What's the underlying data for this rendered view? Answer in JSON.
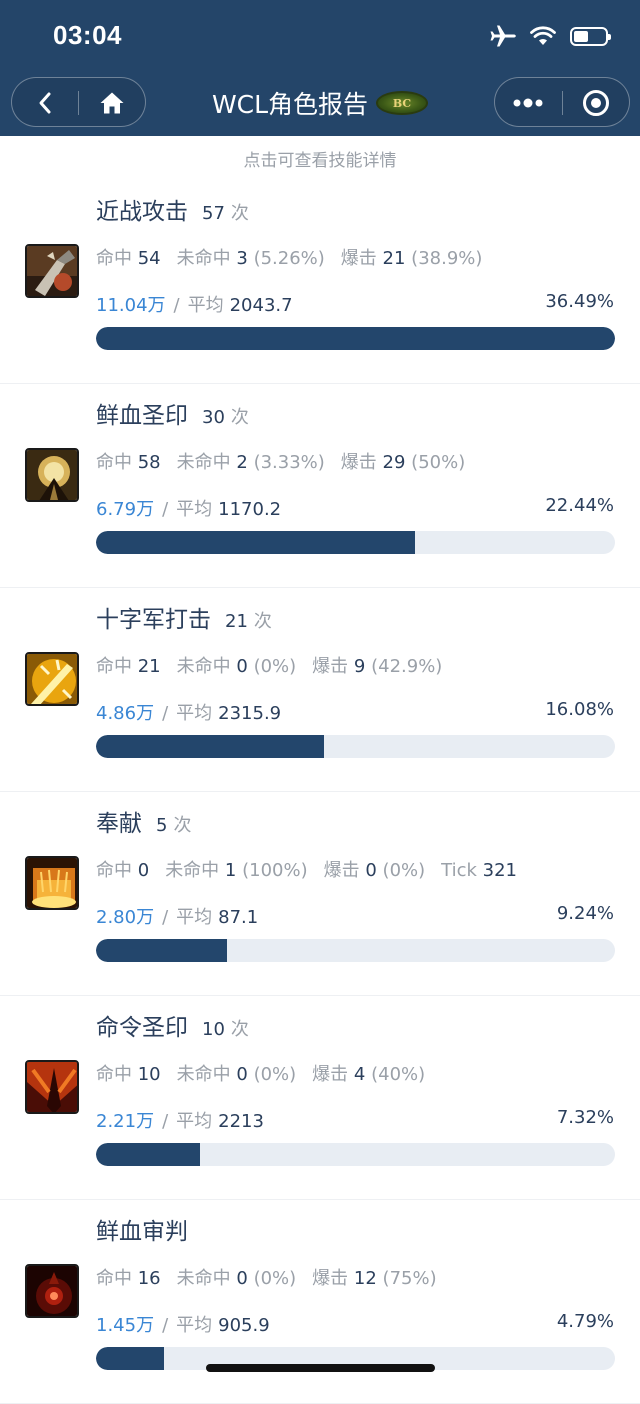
{
  "status_bar": {
    "time": "03:04",
    "icons": [
      "airplane-icon",
      "wifi-icon",
      "battery-icon"
    ],
    "battery_level": 0.45
  },
  "nav": {
    "title": "WCL角色报告",
    "logo_text": "BC",
    "left_buttons": [
      "back-icon",
      "home-icon"
    ],
    "right_buttons": [
      "more-icon",
      "close-circle-icon"
    ]
  },
  "hint": "点击可查看技能详情",
  "labels": {
    "hit": "命中",
    "miss": "未命中",
    "crit": "爆击",
    "tick": "Tick",
    "avg": "平均",
    "times_unit": "次",
    "sep": "/"
  },
  "colors": {
    "header_bg": "#244569",
    "bar_fill": "#23466c",
    "bar_track": "#e8edf3",
    "accent_blue": "#3a86d4"
  },
  "skills": [
    {
      "name": "近战攻击",
      "count": "57",
      "hit": "54",
      "miss": "3",
      "miss_pct": "(5.26%)",
      "crit": "21",
      "crit_pct": "(38.9%)",
      "tick": null,
      "total": "11.04万",
      "avg": "2043.7",
      "pct": "36.49%",
      "bar": 1.0,
      "icon": "melee-attack-icon"
    },
    {
      "name": "鲜血圣印",
      "count": "30",
      "hit": "58",
      "miss": "2",
      "miss_pct": "(3.33%)",
      "crit": "29",
      "crit_pct": "(50%)",
      "tick": null,
      "total": "6.79万",
      "avg": "1170.2",
      "pct": "22.44%",
      "bar": 0.615,
      "icon": "seal-of-blood-icon"
    },
    {
      "name": "十字军打击",
      "count": "21",
      "hit": "21",
      "miss": "0",
      "miss_pct": "(0%)",
      "crit": "9",
      "crit_pct": "(42.9%)",
      "tick": null,
      "total": "4.86万",
      "avg": "2315.9",
      "pct": "16.08%",
      "bar": 0.44,
      "icon": "crusader-strike-icon"
    },
    {
      "name": "奉献",
      "count": "5",
      "hit": "0",
      "miss": "1",
      "miss_pct": "(100%)",
      "crit": "0",
      "crit_pct": "(0%)",
      "tick": "321",
      "total": "2.80万",
      "avg": "87.1",
      "pct": "9.24%",
      "bar": 0.253,
      "icon": "consecration-icon"
    },
    {
      "name": "命令圣印",
      "count": "10",
      "hit": "10",
      "miss": "0",
      "miss_pct": "(0%)",
      "crit": "4",
      "crit_pct": "(40%)",
      "tick": null,
      "total": "2.21万",
      "avg": "2213",
      "pct": "7.32%",
      "bar": 0.2,
      "icon": "seal-of-command-icon"
    },
    {
      "name": "鲜血审判",
      "count": "",
      "hit": "16",
      "miss": "0",
      "miss_pct": "(0%)",
      "crit": "12",
      "crit_pct": "(75%)",
      "tick": null,
      "total": "1.45万",
      "avg": "905.9",
      "pct": "4.79%",
      "bar": 0.131,
      "icon": "judgement-of-blood-icon"
    }
  ]
}
